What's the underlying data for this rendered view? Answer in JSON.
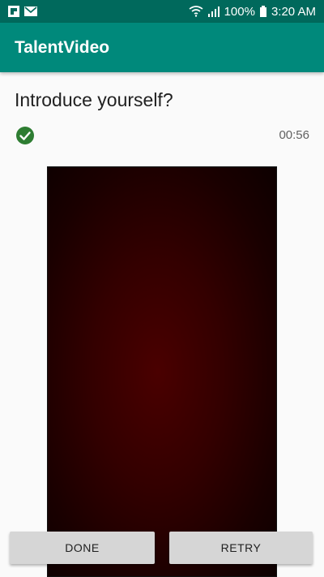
{
  "status_bar": {
    "battery": "100%",
    "time": "3:20 AM",
    "icons": [
      "flipboard-icon",
      "gmail-icon",
      "wifi-icon",
      "signal-icon",
      "battery-icon"
    ]
  },
  "app_bar": {
    "title": "TalentVideo"
  },
  "main": {
    "question": "Introduce yourself?",
    "timer": "00:56",
    "check_icon": "check-circle-icon"
  },
  "actions": {
    "done_label": "DONE",
    "retry_label": "RETRY"
  },
  "colors": {
    "status_bar": "#00695c",
    "app_bar": "#00897b",
    "check": "#2e7d32"
  }
}
